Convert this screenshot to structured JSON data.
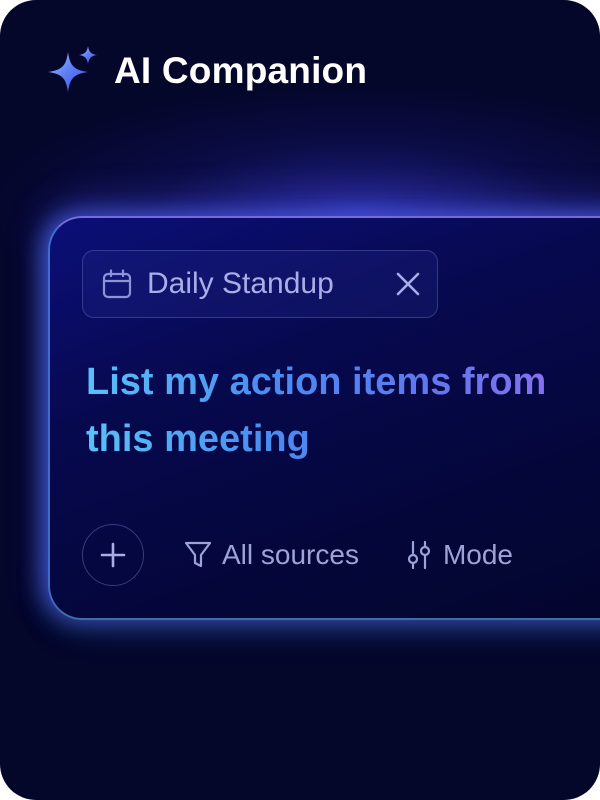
{
  "app": {
    "title": "AI Companion",
    "logo_icon": "sparkle-icon",
    "accent_colors": [
      "#59c2f7",
      "#4a8cf1",
      "#8a6ff0"
    ]
  },
  "prompt_panel": {
    "context_chip": {
      "icon": "calendar-icon",
      "label": "Daily Standup",
      "close_icon": "close-icon"
    },
    "prompt_text": "List my action items from this meeting",
    "toolbar": {
      "add_icon": "plus-icon",
      "sources": {
        "icon": "filter-icon",
        "label": "All sources"
      },
      "mode": {
        "icon": "mode-slider-icon",
        "label": "Mode"
      }
    }
  }
}
